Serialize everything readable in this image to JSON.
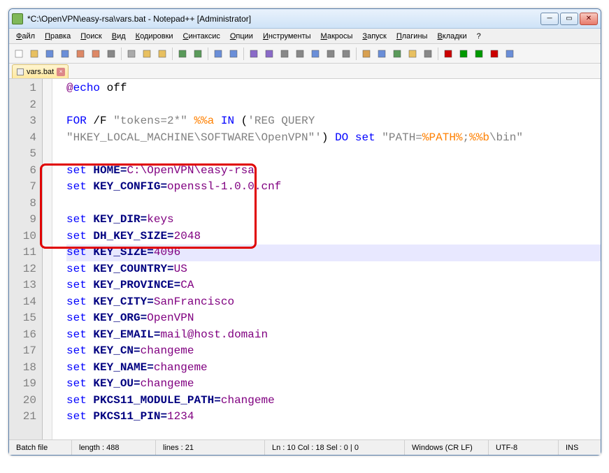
{
  "title": "*C:\\OpenVPN\\easy-rsa\\vars.bat - Notepad++ [Administrator]",
  "menus": [
    "Файл",
    "Правка",
    "Поиск",
    "Вид",
    "Кодировки",
    "Синтаксис",
    "Опции",
    "Инструменты",
    "Макросы",
    "Запуск",
    "Плагины",
    "Вкладки",
    "?"
  ],
  "tab": {
    "label": "vars.bat"
  },
  "code": {
    "lines": [
      {
        "n": 1,
        "seg": [
          {
            "t": "@",
            "c": "val"
          },
          {
            "t": "echo",
            "c": "cmd"
          },
          {
            "t": " off"
          }
        ]
      },
      {
        "n": 2,
        "seg": []
      },
      {
        "n": 3,
        "seg": [
          {
            "t": "FOR",
            "c": "cmd"
          },
          {
            "t": " /F "
          },
          {
            "t": "\"tokens=2*\"",
            "c": "str"
          },
          {
            "t": " "
          },
          {
            "t": "%%a",
            "c": "var"
          },
          {
            "t": " "
          },
          {
            "t": "IN",
            "c": "cmd"
          },
          {
            "t": " ("
          },
          {
            "t": "'REG QUERY",
            "c": "str"
          }
        ]
      },
      {
        "n": null,
        "seg": [
          {
            "t": "\"HKEY_LOCAL_MACHINE\\SOFTWARE\\OpenVPN\"'",
            "c": "str"
          },
          {
            "t": ") "
          },
          {
            "t": "DO",
            "c": "cmd"
          },
          {
            "t": " "
          },
          {
            "t": "set",
            "c": "cmd"
          },
          {
            "t": " "
          },
          {
            "t": "\"PATH=",
            "c": "str"
          },
          {
            "t": "%PATH%",
            "c": "var"
          },
          {
            "t": ";",
            "c": "str"
          },
          {
            "t": "%%b",
            "c": "var"
          },
          {
            "t": "\\bin\"",
            "c": "str"
          }
        ]
      },
      {
        "n": 4,
        "seg": []
      },
      {
        "n": 5,
        "seg": [
          {
            "t": "set",
            "c": "cmd"
          },
          {
            "t": " "
          },
          {
            "t": "HOME",
            "c": "op"
          },
          {
            "t": "=",
            "c": "op"
          },
          {
            "t": "C:\\OpenVPN\\easy-rsa",
            "c": "val"
          }
        ]
      },
      {
        "n": 6,
        "seg": [
          {
            "t": "set",
            "c": "cmd"
          },
          {
            "t": " "
          },
          {
            "t": "KEY_CONFIG",
            "c": "op"
          },
          {
            "t": "=",
            "c": "op"
          },
          {
            "t": "openssl-1.0.0.cnf",
            "c": "val"
          }
        ]
      },
      {
        "n": 7,
        "seg": []
      },
      {
        "n": 8,
        "seg": [
          {
            "t": "set",
            "c": "cmd"
          },
          {
            "t": " "
          },
          {
            "t": "KEY_DIR",
            "c": "op"
          },
          {
            "t": "=",
            "c": "op"
          },
          {
            "t": "keys",
            "c": "val"
          }
        ]
      },
      {
        "n": 9,
        "seg": [
          {
            "t": "set",
            "c": "cmd"
          },
          {
            "t": " "
          },
          {
            "t": "DH_KEY_SIZE",
            "c": "op"
          },
          {
            "t": "=",
            "c": "op"
          },
          {
            "t": "2048",
            "c": "val"
          }
        ]
      },
      {
        "n": 10,
        "seg": [
          {
            "t": "set",
            "c": "cmd"
          },
          {
            "t": " "
          },
          {
            "t": "KEY_SIZE",
            "c": "op"
          },
          {
            "t": "=",
            "c": "op"
          },
          {
            "t": "4096",
            "c": "val"
          }
        ],
        "current": true
      },
      {
        "n": 11,
        "seg": [
          {
            "t": "set",
            "c": "cmd"
          },
          {
            "t": " "
          },
          {
            "t": "KEY_COUNTRY",
            "c": "op"
          },
          {
            "t": "=",
            "c": "op"
          },
          {
            "t": "US",
            "c": "val"
          }
        ]
      },
      {
        "n": 12,
        "seg": [
          {
            "t": "set",
            "c": "cmd"
          },
          {
            "t": " "
          },
          {
            "t": "KEY_PROVINCE",
            "c": "op"
          },
          {
            "t": "=",
            "c": "op"
          },
          {
            "t": "CA",
            "c": "val"
          }
        ]
      },
      {
        "n": 13,
        "seg": [
          {
            "t": "set",
            "c": "cmd"
          },
          {
            "t": " "
          },
          {
            "t": "KEY_CITY",
            "c": "op"
          },
          {
            "t": "=",
            "c": "op"
          },
          {
            "t": "SanFrancisco",
            "c": "val"
          }
        ]
      },
      {
        "n": 14,
        "seg": [
          {
            "t": "set",
            "c": "cmd"
          },
          {
            "t": " "
          },
          {
            "t": "KEY_ORG",
            "c": "op"
          },
          {
            "t": "=",
            "c": "op"
          },
          {
            "t": "OpenVPN",
            "c": "val"
          }
        ]
      },
      {
        "n": 15,
        "seg": [
          {
            "t": "set",
            "c": "cmd"
          },
          {
            "t": " "
          },
          {
            "t": "KEY_EMAIL",
            "c": "op"
          },
          {
            "t": "=",
            "c": "op"
          },
          {
            "t": "mail@host.domain",
            "c": "val"
          }
        ]
      },
      {
        "n": 16,
        "seg": [
          {
            "t": "set",
            "c": "cmd"
          },
          {
            "t": " "
          },
          {
            "t": "KEY_CN",
            "c": "op"
          },
          {
            "t": "=",
            "c": "op"
          },
          {
            "t": "changeme",
            "c": "val"
          }
        ]
      },
      {
        "n": 17,
        "seg": [
          {
            "t": "set",
            "c": "cmd"
          },
          {
            "t": " "
          },
          {
            "t": "KEY_NAME",
            "c": "op"
          },
          {
            "t": "=",
            "c": "op"
          },
          {
            "t": "changeme",
            "c": "val"
          }
        ]
      },
      {
        "n": 18,
        "seg": [
          {
            "t": "set",
            "c": "cmd"
          },
          {
            "t": " "
          },
          {
            "t": "KEY_OU",
            "c": "op"
          },
          {
            "t": "=",
            "c": "op"
          },
          {
            "t": "changeme",
            "c": "val"
          }
        ]
      },
      {
        "n": 19,
        "seg": [
          {
            "t": "set",
            "c": "cmd"
          },
          {
            "t": " "
          },
          {
            "t": "PKCS11_MODULE_PATH",
            "c": "op"
          },
          {
            "t": "=",
            "c": "op"
          },
          {
            "t": "changeme",
            "c": "val"
          }
        ]
      },
      {
        "n": 20,
        "seg": [
          {
            "t": "set",
            "c": "cmd"
          },
          {
            "t": " "
          },
          {
            "t": "PKCS11_PIN",
            "c": "op"
          },
          {
            "t": "=",
            "c": "op"
          },
          {
            "t": "1234",
            "c": "val"
          }
        ]
      },
      {
        "n": 21,
        "seg": []
      }
    ]
  },
  "status": {
    "lang": "Batch file",
    "length": "length : 488",
    "lines": "lines : 21",
    "pos": "Ln : 10   Col : 18   Sel : 0 | 0",
    "eol": "Windows (CR LF)",
    "enc": "UTF-8",
    "ins": "INS"
  },
  "toolbar_icons": [
    "new-file",
    "open-file",
    "save-file",
    "save-all",
    "close-file",
    "close-all",
    "print",
    "|",
    "cut",
    "copy",
    "paste",
    "|",
    "undo",
    "redo",
    "|",
    "find",
    "replace",
    "|",
    "zoom-in",
    "zoom-out",
    "sync-v",
    "sync-h",
    "wrap",
    "all-chars",
    "indent-guide",
    "|",
    "lang-user",
    "doc-map",
    "func-list",
    "folder",
    "monitor",
    "|",
    "record",
    "play",
    "play-mult",
    "stop",
    "save-macro"
  ]
}
